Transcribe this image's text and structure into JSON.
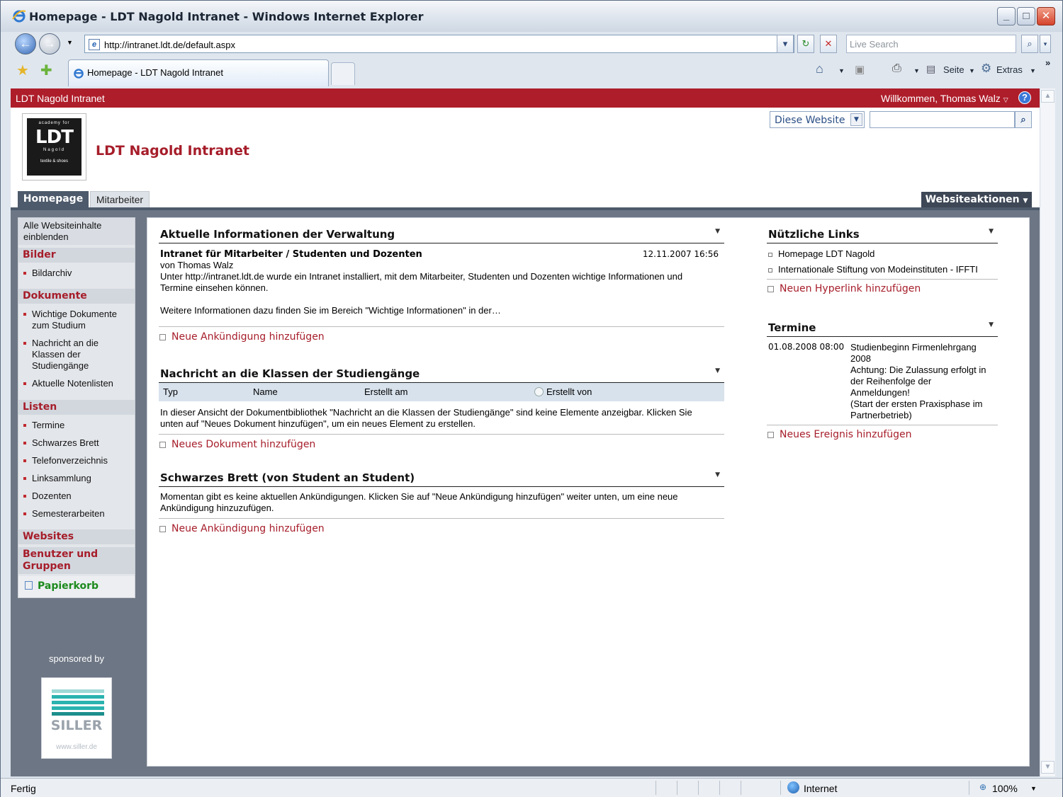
{
  "window": {
    "title": "Homepage - LDT Nagold Intranet - Windows Internet Explorer",
    "minimize": "_",
    "maximize": "□",
    "close": "✕"
  },
  "browser": {
    "url": "http://intranet.ldt.de/default.aspx",
    "search_placeholder": "Live Search",
    "tab_title": "Homepage - LDT Nagold Intranet",
    "toolbar": {
      "page_label": "Seite",
      "extras_label": "Extras",
      "more": "»"
    },
    "status_text": "Fertig",
    "zone": "Internet",
    "zoom": "100%"
  },
  "site": {
    "header_name": "LDT Nagold Intranet",
    "welcome": "Willkommen, Thomas Walz",
    "title": "LDT Nagold Intranet",
    "search_scope": "Diese Website",
    "logo_top": "academy for",
    "logo_main": "LDT",
    "logo_sub": "Nagold",
    "logo_bottom": "textile & shoes",
    "nav_tabs": [
      "Homepage",
      "Mitarbeiter"
    ],
    "site_actions": "Websiteaktionen"
  },
  "quicklaunch": {
    "all_content": "Alle Websiteinhalte einblenden",
    "bilder": "Bilder",
    "bilder_items": [
      "Bildarchiv"
    ],
    "dokumente": "Dokumente",
    "dokumente_items": [
      "Wichtige Dokumente zum Studium",
      "Nachricht an die Klassen der Studiengänge",
      "Aktuelle Notenlisten"
    ],
    "listen": "Listen",
    "listen_items": [
      "Termine",
      "Schwarzes Brett",
      "Telefonverzeichnis",
      "Linksammlung",
      "Dozenten",
      "Semesterarbeiten"
    ],
    "websites": "Websites",
    "users": "Benutzer und Gruppen",
    "recycle": "Papierkorb",
    "sponsored": "sponsored by",
    "sponsor_name": "SILLER",
    "sponsor_url": "www.siller.de"
  },
  "announcements": {
    "title": "Aktuelle Informationen der Verwaltung",
    "item_title": "Intranet für Mitarbeiter / Studenten und Dozenten",
    "item_date": "12.11.2007 16:56",
    "item_author": "von Thomas Walz",
    "item_body": "Unter http://intranet.ldt.de wurde ein Intranet installiert, mit dem Mitarbeiter, Studenten und Dozenten wichtige Informationen und Termine einsehen können.",
    "item_more": "Weitere Informationen dazu finden Sie im Bereich \"Wichtige Informationen\" in der…",
    "add": "Neue Ankündigung hinzufügen"
  },
  "library": {
    "title": "Nachricht an die Klassen der Studiengänge",
    "columns": [
      "Typ",
      "Name",
      "Erstellt am",
      "Erstellt von"
    ],
    "empty": "In dieser Ansicht der Dokumentbibliothek \"Nachricht an die Klassen der Studiengänge\" sind keine Elemente anzeigbar. Klicken Sie unten auf \"Neues Dokument hinzufügen\", um ein neues Element zu erstellen.",
    "add": "Neues Dokument hinzufügen"
  },
  "board": {
    "title": "Schwarzes Brett (von Student an Student)",
    "empty": "Momentan gibt es keine aktuellen Ankündigungen. Klicken Sie auf \"Neue Ankündigung hinzufügen\" weiter unten, um eine neue Ankündigung hinzuzufügen.",
    "add": "Neue Ankündigung hinzufügen"
  },
  "links": {
    "title": "Nützliche Links",
    "items": [
      "Homepage LDT Nagold",
      "Internationale Stiftung von Modeinstituten - IFFTI"
    ],
    "add": "Neuen Hyperlink hinzufügen"
  },
  "events": {
    "title": "Termine",
    "date": "01.08.2008 08:00",
    "event_title": "Studienbeginn Firmenlehrgang 2008",
    "event_body": "Achtung: Die Zulassung erfolgt in der Reihenfolge der Anmeldungen!",
    "event_note": "(Start der ersten Praxisphase im Partnerbetrieb)",
    "add": "Neues Ereignis hinzufügen"
  }
}
